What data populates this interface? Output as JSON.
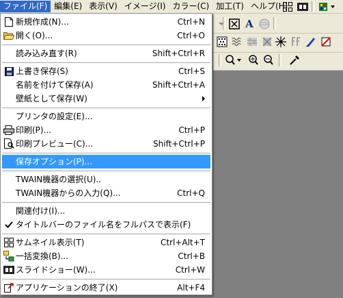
{
  "menubar": {
    "items": [
      {
        "label": "ファイル(F)"
      },
      {
        "label": "編集(E)"
      },
      {
        "label": "表示(V)"
      },
      {
        "label": "イメージ(I)"
      },
      {
        "label": "カラー(C)"
      },
      {
        "label": "加工(T)"
      },
      {
        "label": "ヘルプ(H)"
      }
    ]
  },
  "file_menu": {
    "new": {
      "label": "新規作成(N)...",
      "shortcut": "Ctrl+N"
    },
    "open": {
      "label": "開く(O)...",
      "shortcut": "Ctrl+O"
    },
    "reload": {
      "label": "読み込み直す(R)",
      "shortcut": "Shift+Ctrl+R"
    },
    "save": {
      "label": "上書き保存(S)",
      "shortcut": "Ctrl+S"
    },
    "save_as": {
      "label": "名前を付けて保存(A)",
      "shortcut": "Shift+Ctrl+A"
    },
    "save_wallpaper": {
      "label": "壁紙として保存(W)"
    },
    "printer_setup": {
      "label": "プリンタの設定(E)..."
    },
    "print": {
      "label": "印刷(P)...",
      "shortcut": "Ctrl+P"
    },
    "print_preview": {
      "label": "印刷プレビュー(C)...",
      "shortcut": "Shift+Ctrl+P"
    },
    "save_options": {
      "label": "保存オプション(P)..."
    },
    "twain_select": {
      "label": "TWAIN機器の選択(U).."
    },
    "twain_input": {
      "label": "TWAIN機器からの入力(Q)...",
      "shortcut": "Ctrl+Q"
    },
    "associate": {
      "label": "関連付け(I)..."
    },
    "fullpath_title": {
      "label": "タイトルバーのファイル名をフルパスで表示(F)"
    },
    "thumbnail": {
      "label": "サムネイル表示(T)",
      "shortcut": "Ctrl+Alt+T"
    },
    "batch": {
      "label": "一括変換(B)...",
      "shortcut": "Ctrl+B"
    },
    "slideshow": {
      "label": "スライドショー(W)...",
      "shortcut": "Ctrl+W"
    },
    "exit": {
      "label": "アプリケーションの終了(X)",
      "shortcut": "Alt+F4"
    }
  },
  "colors": {
    "highlight": "#3399ff",
    "menubar_active": "#3169c6",
    "workspace": "#808080",
    "chrome": "#ece9d8"
  }
}
